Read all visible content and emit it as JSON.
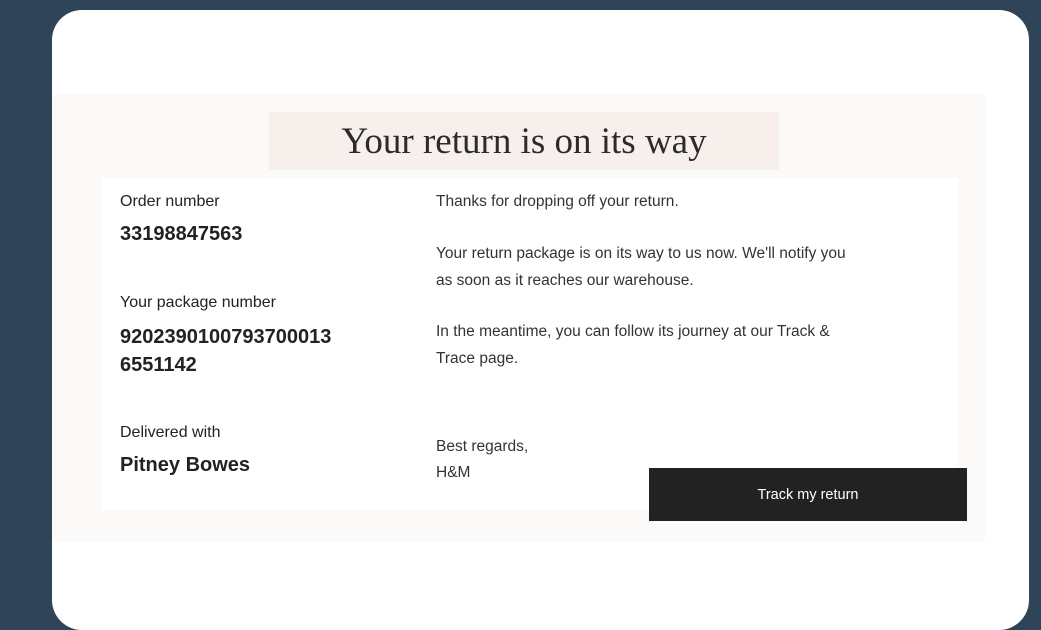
{
  "email": {
    "title": "Your return is on its way",
    "order": {
      "label": "Order number",
      "value": "33198847563"
    },
    "package": {
      "label": "Your package number",
      "value_line1": "9202390100793700013",
      "value_line2": "6551142"
    },
    "carrier": {
      "label": "Delivered with",
      "value": "Pitney Bowes"
    },
    "messages": {
      "thanks": "Thanks for dropping off your return.",
      "status_line1": "Your return package is on its way to us now. We'll notify you",
      "status_line2": "as soon as it reaches our warehouse.",
      "follow_line1": "In the meantime, you can follow its journey at our Track &",
      "follow_line2": "Trace page.",
      "regards": "Best regards,",
      "signature": "H&M"
    },
    "track_button_label": "Track my return"
  }
}
